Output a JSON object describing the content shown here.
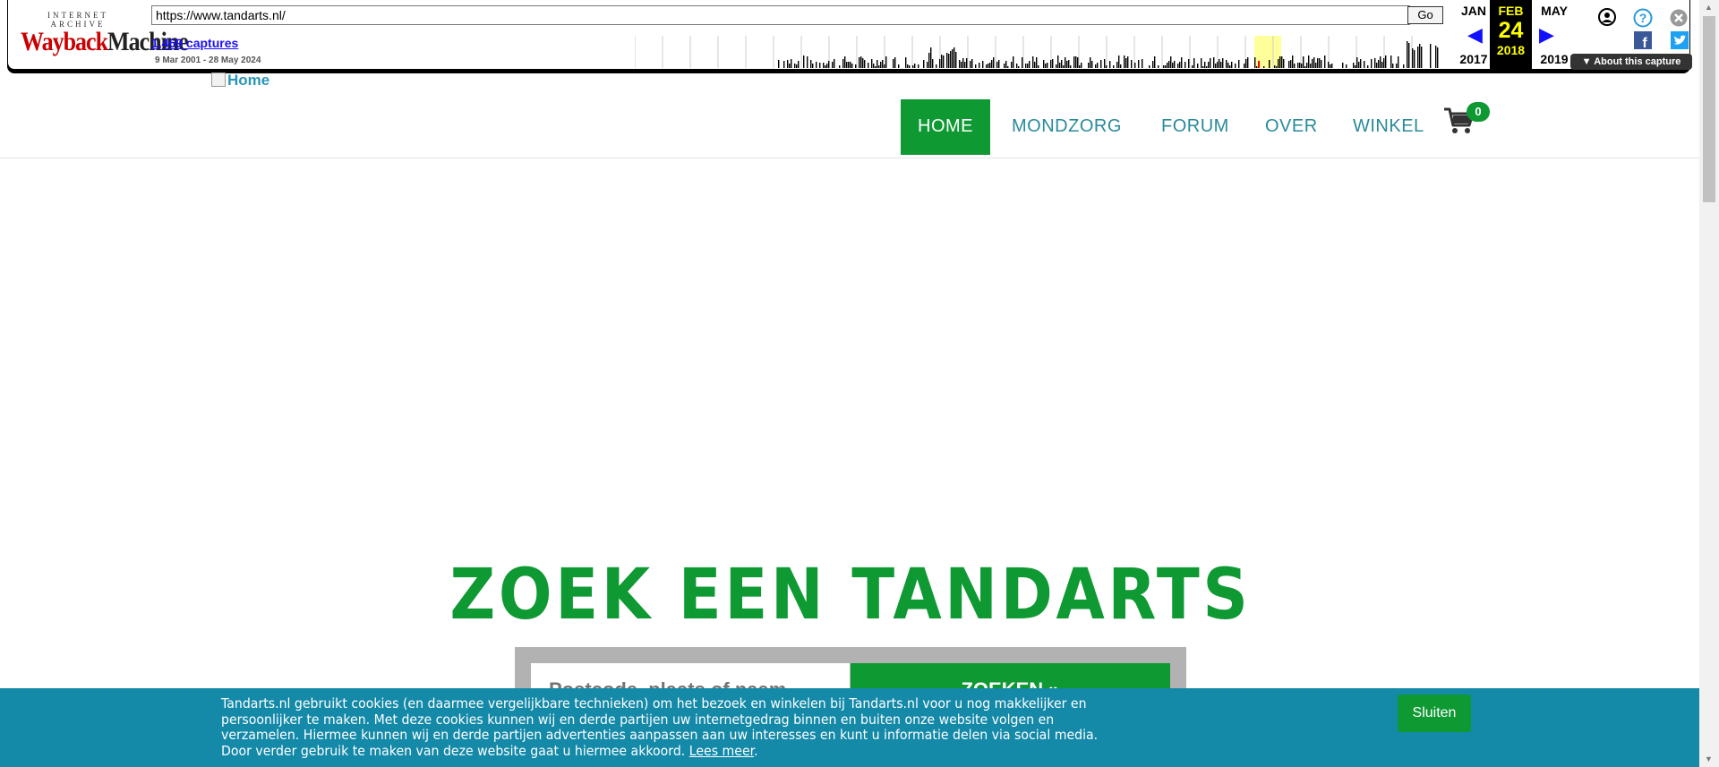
{
  "wayback": {
    "logo_top": "INTERNET ARCHIVE",
    "logo_main_a": "Wayback",
    "logo_main_b": "Machine",
    "url": "https://www.tandarts.nl/",
    "go_label": "Go",
    "captures": "1,469 captures",
    "range": "9 Mar 2001 - 28 May 2024",
    "prev_month": "JAN",
    "prev_year": "2017",
    "cur_month": "FEB",
    "cur_day": "24",
    "cur_year": "2018",
    "next_month": "MAY",
    "next_year": "2019",
    "about": "About this capture"
  },
  "header": {
    "logo_alt": "Home",
    "nav": [
      "HOME",
      "MONDZORG",
      "FORUM",
      "OVER",
      "WINKEL"
    ],
    "cart_count": "0"
  },
  "hero": {
    "title": "ZOEK EEN TANDARTS",
    "search_placeholder": "Postcode, plaats of naam",
    "search_button": "ZOEKEN »"
  },
  "cookie": {
    "text": "Tandarts.nl gebruikt cookies (en daarmee vergelijkbare technieken) om het bezoek en winkelen bij Tandarts.nl voor u nog makkelijker en persoonlijker te maken. Met deze cookies kunnen wij en derde partijen uw internetgedrag binnen en buiten onze website volgen en verzamelen. Hiermee kunnen wij en derde partijen advertenties aanpassen aan uw interesses en kunt u informatie delen via social media. Door verder gebruik te maken van deze website gaat u hiermee akkoord.",
    "link": "Lees meer",
    "button": "Sluiten"
  },
  "colors": {
    "brand_green": "#0e9933",
    "nav_teal": "#2a8a9a",
    "cookie_bg": "#1489a8"
  }
}
